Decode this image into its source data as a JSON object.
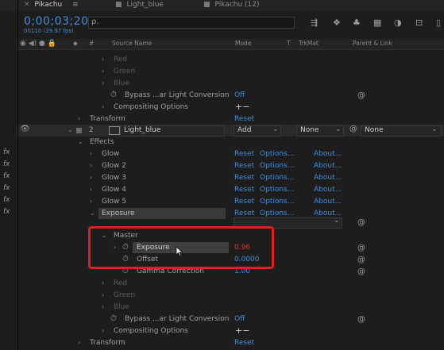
{
  "tabs": [
    {
      "label": "Pikachu",
      "active": true
    },
    {
      "label": "Light_blue",
      "active": false
    },
    {
      "label": "Pikachu (12)",
      "active": false
    }
  ],
  "timecode": "0;00;03;20",
  "fps_readout": "00110 (29.97 fps)",
  "search": {
    "placeholder": "ρ."
  },
  "columns": {
    "index": "#",
    "source_name": "Source Name",
    "mode": "Mode",
    "t": "T",
    "trkmat": "TrkMat",
    "parent": "Parent & Link"
  },
  "rows": {
    "red1": "Red",
    "green1": "Green",
    "blue1": "Blue",
    "bypass1": "Bypass ...ar Light Conversion",
    "bypass1_val": "Off",
    "compositing1": "Compositing Options",
    "compositing1_val": "+−",
    "transform1": "Transform",
    "transform1_val": "Reset",
    "layer_num": "2",
    "layer_name": "Light_blue",
    "layer_mode": "Add",
    "layer_trkmat": "None",
    "layer_parent": "None",
    "effects": "Effects",
    "glow1": "Glow",
    "glow2": "Glow 2",
    "glow3": "Glow 3",
    "glow4": "Glow 4",
    "glow5": "Glow 5",
    "exposure": "Exposure",
    "reset": "Reset",
    "options": "Options...",
    "about": "About...",
    "master": "Master",
    "exposure_prop": "Exposure",
    "exposure_val": "0.96",
    "offset": "Offset",
    "offset_val": "0.0000",
    "gamma": "Gamma Correction",
    "gamma_val": "1.00",
    "red2": "Red",
    "green2": "Green",
    "blue2": "Blue",
    "bypass2": "Bypass ...ar Light Conversion",
    "bypass2_val": "Off",
    "compositing2": "Compositing Options",
    "compositing2_val": "+−",
    "transform2": "Transform",
    "transform2_val": "Reset"
  },
  "colors": {
    "accent": "#3d8fdb",
    "highlight": "#e41e1e",
    "value_red": "#d3392d"
  }
}
